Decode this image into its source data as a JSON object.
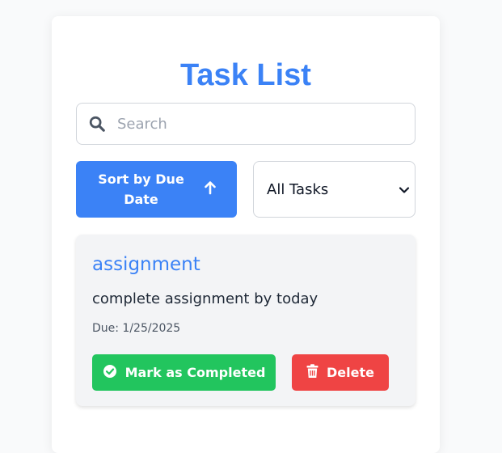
{
  "page": {
    "title": "Task List"
  },
  "search": {
    "placeholder": "Search",
    "value": "",
    "icon": "search-icon"
  },
  "controls": {
    "sort_label": "Sort by Due Date",
    "sort_icon": "arrow-up-icon",
    "filter_selected": "All Tasks",
    "filter_options": [
      "All Tasks"
    ]
  },
  "tasks": [
    {
      "title": "assignment",
      "description": "complete assignment by today",
      "due": "Due: 1/25/2025",
      "complete_label": "Mark as Completed",
      "delete_label": "Delete"
    }
  ],
  "colors": {
    "accent": "#3b82f6",
    "success": "#22c55e",
    "danger": "#ef4444"
  }
}
